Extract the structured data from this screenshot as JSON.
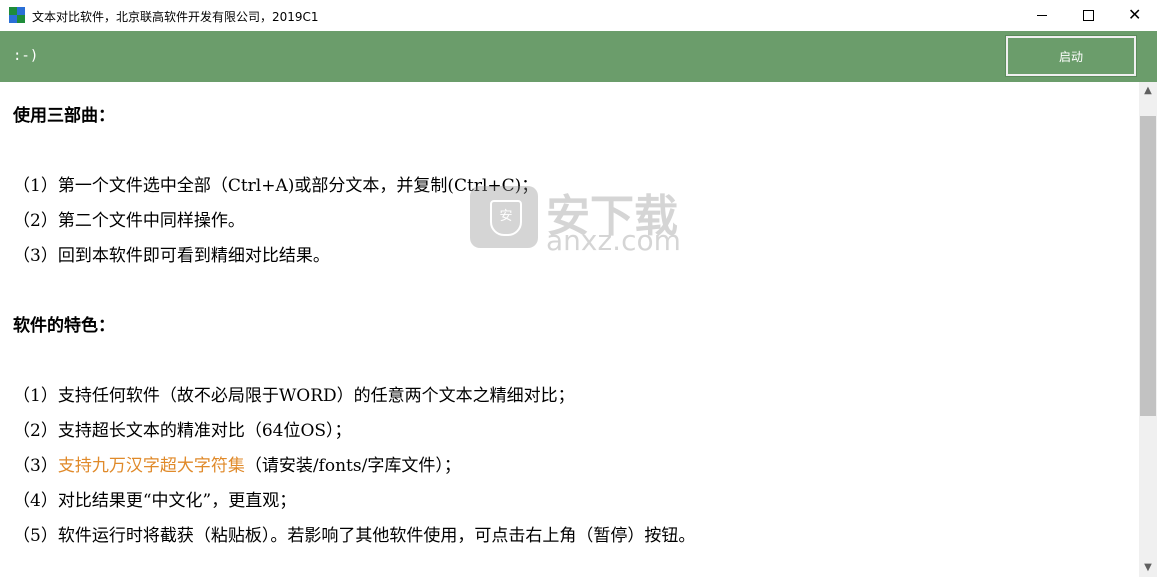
{
  "window": {
    "title": "文本对比软件，北京联高软件开发有限公司，2019C1",
    "minimize_glyph": "",
    "maximize_glyph": "",
    "close_glyph": "✕",
    "icon_colors": [
      "#1e8c3a",
      "#2a6fd6",
      "#2a6fd6",
      "#1e8c3a"
    ]
  },
  "toolbar": {
    "status": ":-)",
    "start_label": "启动",
    "bg_color": "#6b9d6b"
  },
  "content": {
    "heading1": "使用三部曲：",
    "steps": [
      "（1）第一个文件选中全部（Ctrl+A)或部分文本，并复制(Ctrl+C)；",
      "（2）第二个文件中同样操作。",
      "（3）回到本软件即可看到精细对比结果。"
    ],
    "heading2": "软件的特色：",
    "features": [
      "（1）支持任何软件（故不必局限于WORD）的任意两个文本之精细对比；",
      "（2）支持超长文本的精准对比（64位OS）；"
    ],
    "feature3_prefix": "（3）",
    "feature3_highlight": "支持九万汉字超大字符集",
    "feature3_suffix": "（请安装/fonts/字库文件）；",
    "feature4": "（4）对比结果更“中文化”，更直观；",
    "feature5": "（5）软件运行时将截获（粘贴板）。若影响了其他软件使用，可点击右上角（暂停）按钮。",
    "highlight_color": "#e08a2a"
  },
  "watermark": {
    "cn": "安下载",
    "en": "anxz.com",
    "shield_label": "安"
  },
  "scrollbar": {
    "up_glyph": "▲",
    "down_glyph": "▼"
  }
}
